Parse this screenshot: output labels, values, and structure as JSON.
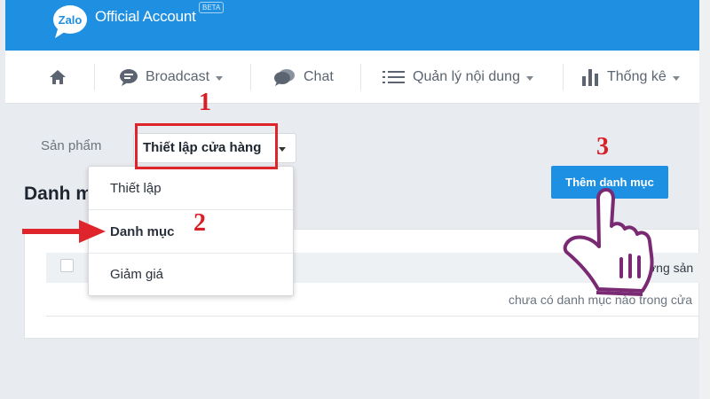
{
  "header": {
    "brand": "Official Account",
    "logo_text": "Zalo",
    "beta": "BETA",
    "colors": {
      "header_bg": "#1e8fe1",
      "accent": "#1e90e3",
      "annotation_red": "#d81f26"
    }
  },
  "nav": {
    "items": [
      {
        "label": "",
        "icon": "home-icon"
      },
      {
        "label": "Broadcast",
        "icon": "chat-bubble-icon",
        "has_caret": true
      },
      {
        "label": "Chat",
        "icon": "chat-icon"
      },
      {
        "label": "Quản lý nội dung",
        "icon": "list-icon",
        "has_caret": true
      },
      {
        "label": "Thống kê",
        "icon": "bar-chart-icon",
        "has_caret": true
      }
    ]
  },
  "toolbar": {
    "breadcrumb": "Sản phẩm",
    "select_value": "Thiết lập cửa hàng",
    "add_button": "Thêm danh mục"
  },
  "dropdown": {
    "items": [
      "Thiết lập",
      "Danh mục",
      "Giảm giá"
    ]
  },
  "main": {
    "title": "Danh m",
    "column_right": "ợng sản",
    "empty_text": "chưa có danh mục nào trong cửa"
  },
  "annotations": {
    "step1": "1",
    "step2": "2",
    "step3": "3"
  }
}
